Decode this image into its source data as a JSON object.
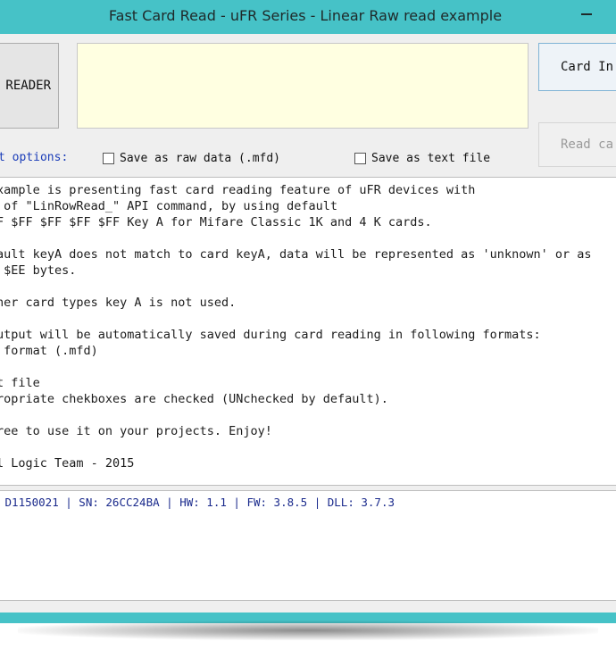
{
  "window": {
    "title": "Fast Card Read - uFR Series - Linear Raw read example"
  },
  "toolbar": {
    "reader_button_label": "READER",
    "card_info_button_label": "Card In",
    "read_card_button_label": "Read ca"
  },
  "options": {
    "label": "t options:",
    "save_raw_label": "Save as raw data (.mfd)",
    "save_text_label": "Save as text file"
  },
  "info_text": [
    "xample is presenting fast card reading feature of uFR devices with",
    " of \"LinRowRead_\" API command, by using default",
    "F $FF $FF $FF $FF Key A for Mifare Classic 1K and 4 K cards.",
    "",
    "ault keyA does not match to card keyA, data will be represented as 'unknown' or as",
    " $EE bytes.",
    "",
    "her card types key A is not used.",
    "",
    "utput will be automatically saved during card reading in following formats:",
    " format (.mfd)",
    "",
    "t file",
    "ropriate chekboxes are checked (UNchecked by default).",
    "",
    "ree to use it on your projects. Enjoy!",
    "",
    "l Logic Team - 2015"
  ],
  "status": {
    "text": " D1150021 | SN: 26CC24BA | HW: 1.1 | FW: 3.8.5 | DLL: 3.7.3"
  }
}
